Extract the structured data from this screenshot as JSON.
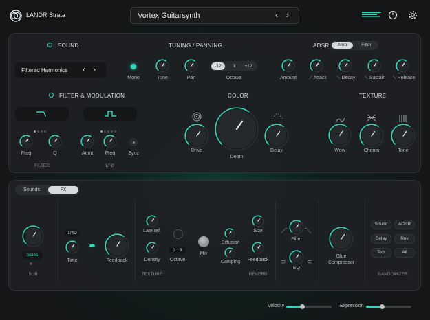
{
  "app": {
    "name": "LANDR Strata",
    "preset": "Vortex Guitarsynth"
  },
  "colors": {
    "accent": "#2fd6b8",
    "bg": "#141618",
    "panel": "#1e2023"
  },
  "sound": {
    "title": "SOUND",
    "patch": "Filtered Harmonics",
    "mono": "Mono"
  },
  "tuning": {
    "title": "TUNING / PANNING",
    "tune": "Tune",
    "pan": "Pan",
    "octave": "Octave",
    "oct_opts": [
      "-12",
      "0",
      "+12"
    ]
  },
  "adsr": {
    "title": "ADSR",
    "tabs": [
      "Amp",
      "Filter"
    ],
    "knobs": [
      "Amount",
      "Attack",
      "Decay",
      "Sustain",
      "Release"
    ]
  },
  "filtermod": {
    "title": "FILTER & MODULATION",
    "freq": "Freq",
    "q": "Q",
    "filter": "FILTER",
    "amnt": "Amnt",
    "freq2": "Freq",
    "sync": "Sync",
    "lfo": "LFO"
  },
  "color": {
    "title": "COLOR",
    "drive": "Drive",
    "depth": "Depth",
    "delay": "Delay"
  },
  "texture": {
    "title": "TEXTURE",
    "wow": "Wow",
    "chorus": "Chorus",
    "tone": "Tone"
  },
  "bottom": {
    "tabs": [
      "Sounds",
      "FX"
    ],
    "sub": {
      "mode": "Static",
      "label": "SUB"
    },
    "delay": {
      "time_val": "1/4D",
      "time": "Time",
      "feedback": "Feedback"
    },
    "texture": {
      "lateref": "Late ref.",
      "density": "Density",
      "octave_val": "3 : 3",
      "octave": "Octave",
      "mix": "Mix",
      "label": "TEXTURE"
    },
    "reverb": {
      "diffusion": "Diffusion",
      "damping": "Damping",
      "size": "Size",
      "feedback": "Feedback",
      "label": "REVERB"
    },
    "eq": {
      "filter": "Filter",
      "eq": "EQ"
    },
    "glue": {
      "label1": "Glue",
      "label2": "Compressor"
    },
    "randomizer": {
      "label": "RANDOMIZER",
      "buttons": [
        "Sound",
        "ADSR",
        "Delay",
        "Rev",
        "Text",
        "All"
      ]
    }
  },
  "footer": {
    "velocity": "Velocity",
    "expression": "Expression",
    "velocity_val": 0.35,
    "expression_val": 0.35
  }
}
